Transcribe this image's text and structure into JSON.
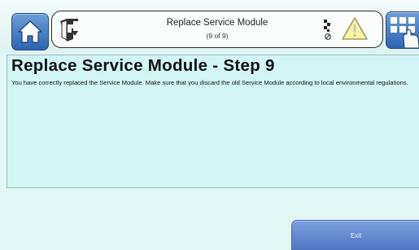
{
  "header": {
    "title": "Replace Service Module",
    "step": "(9 of 9)",
    "home_icon": "home-icon",
    "menu_icon": "menu-book-icon",
    "status_icon": "transfer-status-icon",
    "warning_icon": "warning-triangle-icon",
    "grid_icon": "app-grid-touch-icon"
  },
  "content": {
    "heading": "Replace Service Module - Step 9",
    "body": "You have correctly replaced the Service Module. Make sure that you discard the old Service Module according to local environmental regulations."
  },
  "footer": {
    "exit_label": "Exit"
  },
  "colors": {
    "accent_blue": "#2e63b1",
    "background": "#e3f6f6",
    "content_panel": "#d2f5f5",
    "warning_yellow": "#fff59a"
  }
}
